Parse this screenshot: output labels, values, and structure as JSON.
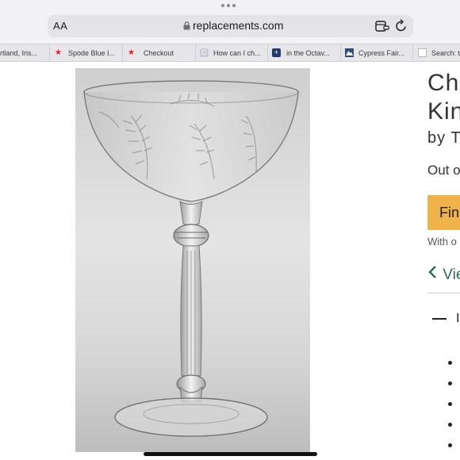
{
  "browser": {
    "text_size_label": "AA",
    "url": "replacements.com",
    "extension_icon": "tab-extension-icon",
    "reload_icon": "reload-icon"
  },
  "tabs": [
    {
      "label": "rtland, Iris...",
      "icon": "none"
    },
    {
      "label": "Spode Blue I...",
      "icon": "red-star-icon"
    },
    {
      "label": "Checkout",
      "icon": "red-star-icon"
    },
    {
      "label": "How can I ch...",
      "icon": "c-favicon-icon"
    },
    {
      "label": "in the Octav...",
      "icon": "cross-favicon-icon"
    },
    {
      "label": "Cypress Fair...",
      "icon": "mountain-favicon-icon"
    },
    {
      "label": "Search: t",
      "icon": "page-favicon-icon"
    }
  ],
  "product": {
    "image_alt": "etched crystal champagne / tall sherbet glass",
    "title_line1": "Ch",
    "title_line2": "Kin",
    "byline": "by T",
    "stock_status": "Out o",
    "find_button_label": "Fin",
    "with_text": "With o",
    "view_link_label": "Vie",
    "section_label": "I",
    "accent_color": "#f0b34a",
    "link_color": "#2d6a52"
  }
}
